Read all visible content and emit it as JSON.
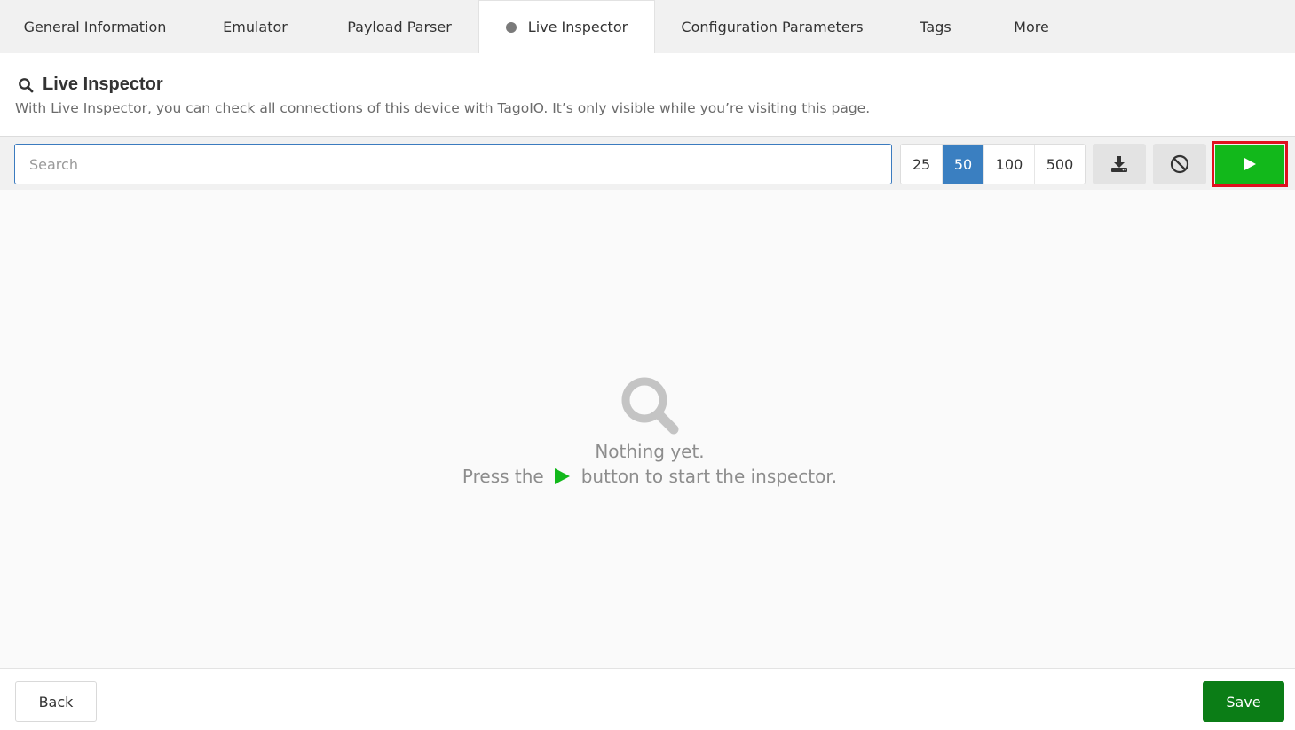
{
  "tabs": [
    {
      "label": "General Information",
      "active": false
    },
    {
      "label": "Emulator",
      "active": false
    },
    {
      "label": "Payload Parser",
      "active": false
    },
    {
      "label": "Live Inspector",
      "active": true
    },
    {
      "label": "Configuration Parameters",
      "active": false
    },
    {
      "label": "Tags",
      "active": false
    },
    {
      "label": "More",
      "active": false
    }
  ],
  "header": {
    "icon": "search-icon",
    "title": "Live Inspector",
    "subtitle": "With Live Inspector, you can check all connections of this device with TagoIO. It’s only visible while you’re visiting this page."
  },
  "toolbar": {
    "search": {
      "placeholder": "Search",
      "value": ""
    },
    "page_sizes": [
      "25",
      "50",
      "100",
      "500"
    ],
    "selected_page_size": "50",
    "download_icon": "download-icon",
    "clear_icon": "ban-icon",
    "play_icon": "play-icon"
  },
  "empty_state": {
    "icon": "search-icon",
    "line1": "Nothing yet.",
    "line2_before": "Press the",
    "line2_after": "button to start the inspector."
  },
  "footer": {
    "back_label": "Back",
    "save_label": "Save"
  },
  "colors": {
    "accent_blue": "#3a7fc1",
    "play_green": "#12b81b",
    "save_green": "#0b7d16",
    "highlight_red": "#e0101e"
  }
}
